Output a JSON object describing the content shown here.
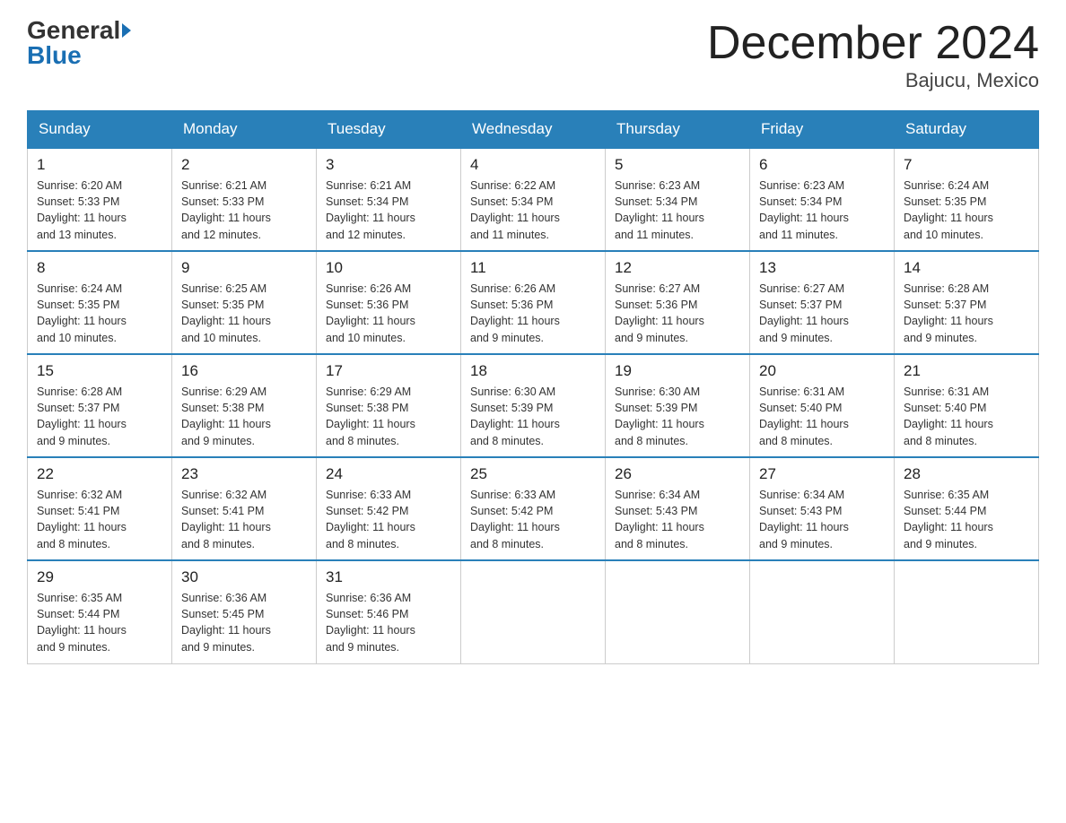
{
  "header": {
    "logo_general": "General",
    "logo_blue": "Blue",
    "month_title": "December 2024",
    "location": "Bajucu, Mexico"
  },
  "weekdays": [
    "Sunday",
    "Monday",
    "Tuesday",
    "Wednesday",
    "Thursday",
    "Friday",
    "Saturday"
  ],
  "weeks": [
    [
      {
        "day": "1",
        "sunrise": "6:20 AM",
        "sunset": "5:33 PM",
        "daylight": "11 hours and 13 minutes."
      },
      {
        "day": "2",
        "sunrise": "6:21 AM",
        "sunset": "5:33 PM",
        "daylight": "11 hours and 12 minutes."
      },
      {
        "day": "3",
        "sunrise": "6:21 AM",
        "sunset": "5:34 PM",
        "daylight": "11 hours and 12 minutes."
      },
      {
        "day": "4",
        "sunrise": "6:22 AM",
        "sunset": "5:34 PM",
        "daylight": "11 hours and 11 minutes."
      },
      {
        "day": "5",
        "sunrise": "6:23 AM",
        "sunset": "5:34 PM",
        "daylight": "11 hours and 11 minutes."
      },
      {
        "day": "6",
        "sunrise": "6:23 AM",
        "sunset": "5:34 PM",
        "daylight": "11 hours and 11 minutes."
      },
      {
        "day": "7",
        "sunrise": "6:24 AM",
        "sunset": "5:35 PM",
        "daylight": "11 hours and 10 minutes."
      }
    ],
    [
      {
        "day": "8",
        "sunrise": "6:24 AM",
        "sunset": "5:35 PM",
        "daylight": "11 hours and 10 minutes."
      },
      {
        "day": "9",
        "sunrise": "6:25 AM",
        "sunset": "5:35 PM",
        "daylight": "11 hours and 10 minutes."
      },
      {
        "day": "10",
        "sunrise": "6:26 AM",
        "sunset": "5:36 PM",
        "daylight": "11 hours and 10 minutes."
      },
      {
        "day": "11",
        "sunrise": "6:26 AM",
        "sunset": "5:36 PM",
        "daylight": "11 hours and 9 minutes."
      },
      {
        "day": "12",
        "sunrise": "6:27 AM",
        "sunset": "5:36 PM",
        "daylight": "11 hours and 9 minutes."
      },
      {
        "day": "13",
        "sunrise": "6:27 AM",
        "sunset": "5:37 PM",
        "daylight": "11 hours and 9 minutes."
      },
      {
        "day": "14",
        "sunrise": "6:28 AM",
        "sunset": "5:37 PM",
        "daylight": "11 hours and 9 minutes."
      }
    ],
    [
      {
        "day": "15",
        "sunrise": "6:28 AM",
        "sunset": "5:37 PM",
        "daylight": "11 hours and 9 minutes."
      },
      {
        "day": "16",
        "sunrise": "6:29 AM",
        "sunset": "5:38 PM",
        "daylight": "11 hours and 9 minutes."
      },
      {
        "day": "17",
        "sunrise": "6:29 AM",
        "sunset": "5:38 PM",
        "daylight": "11 hours and 8 minutes."
      },
      {
        "day": "18",
        "sunrise": "6:30 AM",
        "sunset": "5:39 PM",
        "daylight": "11 hours and 8 minutes."
      },
      {
        "day": "19",
        "sunrise": "6:30 AM",
        "sunset": "5:39 PM",
        "daylight": "11 hours and 8 minutes."
      },
      {
        "day": "20",
        "sunrise": "6:31 AM",
        "sunset": "5:40 PM",
        "daylight": "11 hours and 8 minutes."
      },
      {
        "day": "21",
        "sunrise": "6:31 AM",
        "sunset": "5:40 PM",
        "daylight": "11 hours and 8 minutes."
      }
    ],
    [
      {
        "day": "22",
        "sunrise": "6:32 AM",
        "sunset": "5:41 PM",
        "daylight": "11 hours and 8 minutes."
      },
      {
        "day": "23",
        "sunrise": "6:32 AM",
        "sunset": "5:41 PM",
        "daylight": "11 hours and 8 minutes."
      },
      {
        "day": "24",
        "sunrise": "6:33 AM",
        "sunset": "5:42 PM",
        "daylight": "11 hours and 8 minutes."
      },
      {
        "day": "25",
        "sunrise": "6:33 AM",
        "sunset": "5:42 PM",
        "daylight": "11 hours and 8 minutes."
      },
      {
        "day": "26",
        "sunrise": "6:34 AM",
        "sunset": "5:43 PM",
        "daylight": "11 hours and 8 minutes."
      },
      {
        "day": "27",
        "sunrise": "6:34 AM",
        "sunset": "5:43 PM",
        "daylight": "11 hours and 9 minutes."
      },
      {
        "day": "28",
        "sunrise": "6:35 AM",
        "sunset": "5:44 PM",
        "daylight": "11 hours and 9 minutes."
      }
    ],
    [
      {
        "day": "29",
        "sunrise": "6:35 AM",
        "sunset": "5:44 PM",
        "daylight": "11 hours and 9 minutes."
      },
      {
        "day": "30",
        "sunrise": "6:36 AM",
        "sunset": "5:45 PM",
        "daylight": "11 hours and 9 minutes."
      },
      {
        "day": "31",
        "sunrise": "6:36 AM",
        "sunset": "5:46 PM",
        "daylight": "11 hours and 9 minutes."
      },
      null,
      null,
      null,
      null
    ]
  ],
  "labels": {
    "sunrise": "Sunrise:",
    "sunset": "Sunset:",
    "daylight": "Daylight:"
  }
}
